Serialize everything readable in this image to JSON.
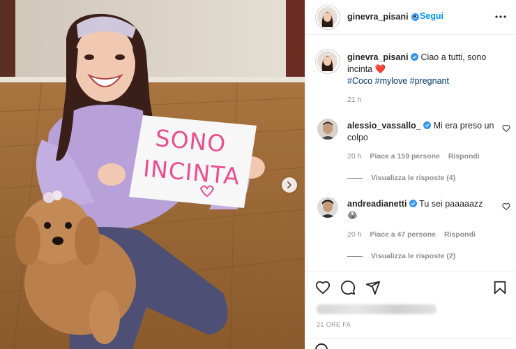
{
  "post": {
    "author": "ginevra_pisani",
    "follow_label": "Segui",
    "separator": "•",
    "caption": {
      "username": "ginevra_pisani",
      "text": "Ciao a tutti, sono incinta",
      "emoji": "❤️",
      "hashtags": [
        "#Coco",
        "#mylove",
        "#pregnant"
      ],
      "time": "21 h"
    },
    "photo": {
      "sign_line1": "SONO",
      "sign_line2": "INCINTA"
    },
    "comments": [
      {
        "username": "alessio_vassallo_",
        "text": "Mi era preso un colpo",
        "time": "20 h",
        "likes": "Piace a 159 persone",
        "reply_label": "Rispondi",
        "view_replies": "Visualizza le risposte (4)"
      },
      {
        "username": "andreadianetti",
        "text": "Tu sei paaaaazz",
        "emoji": "😂",
        "time": "20 h",
        "likes": "Piace a 47 persone",
        "reply_label": "Rispondi",
        "view_replies": "Visualizza le risposte (2)"
      }
    ],
    "date": "21 ORE FA"
  },
  "colors": {
    "accent": "#0095f6",
    "hashtag": "#00376b",
    "muted": "#8e8e8e",
    "text": "#262626",
    "sign": "#e8508f",
    "heart": "#e0245e"
  },
  "icons": [
    "verified-icon",
    "more-options-icon",
    "carousel-next-icon",
    "heart-icon",
    "comment-icon",
    "share-icon",
    "bookmark-icon"
  ]
}
